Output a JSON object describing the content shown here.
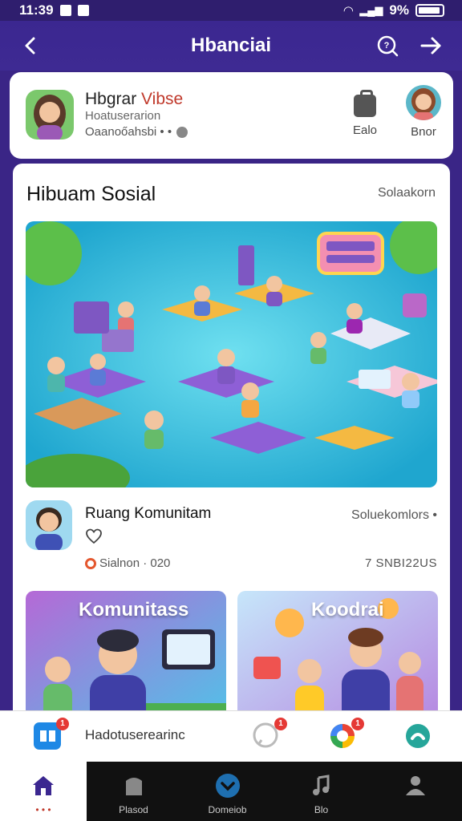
{
  "status": {
    "time": "11:39",
    "battery": "9%"
  },
  "app_bar": {
    "title": "Hbanciai"
  },
  "profile": {
    "name_main": "Hbgrar ",
    "name_accent": "Vibse",
    "subtitle": "Hoatuserarion",
    "location": "Oaanoőahsbi • •",
    "edit_label": "Ealo",
    "user_label": "Bnor"
  },
  "section": {
    "title": "Hibuam Sosial",
    "link": "Solaakorn"
  },
  "post": {
    "title": "Ruang Komunitam",
    "meta_right": "Soluekomlors •",
    "stats": "Sialnon · 020",
    "date": "7 SNBI22US"
  },
  "cards": [
    {
      "title": "Komunitass"
    },
    {
      "title": "Koodrai"
    }
  ],
  "quick_bar": {
    "label": "Hadotuserearinc",
    "badges": [
      "1",
      "1",
      "1"
    ]
  },
  "nav": [
    {
      "label": ""
    },
    {
      "label": "Plasod"
    },
    {
      "label": "Domeiob"
    },
    {
      "label": "Blo"
    },
    {
      "label": ""
    }
  ],
  "colors": {
    "primary": "#3b2790",
    "accent_red": "#c0392b",
    "badge": "#e53935"
  }
}
